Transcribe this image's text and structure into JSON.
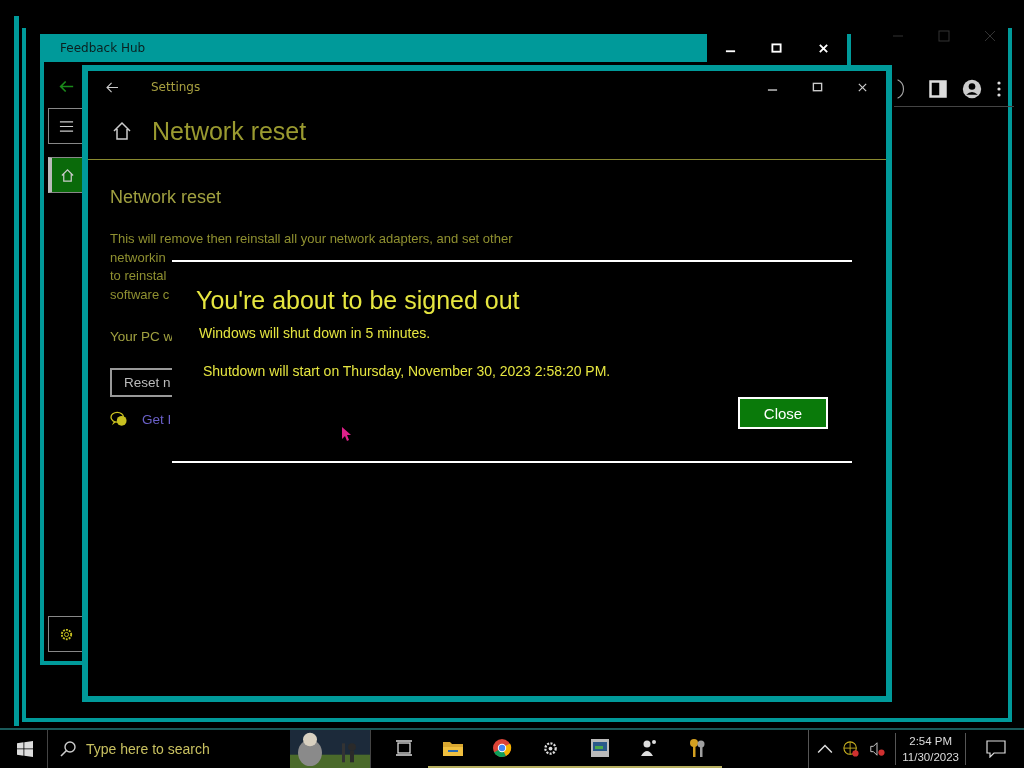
{
  "feedback_hub": {
    "title": "Feedback Hub",
    "nav": [
      {
        "kind": "back",
        "selected": false
      },
      {
        "kind": "menu",
        "selected": false
      },
      {
        "kind": "home",
        "selected": true
      },
      {
        "kind": "settings",
        "selected": false
      }
    ]
  },
  "settings_window": {
    "title": "Settings",
    "page_title": "Network reset",
    "section_title": "Network reset",
    "paragraph_lines": [
      "This will remove then reinstall all your network adapters, and set other",
      "networkin",
      "to reinstal",
      "software c"
    ],
    "note": "Your PC w",
    "reset_button": "Reset n",
    "help_link": "Get I"
  },
  "dialog": {
    "title": "You're about to be signed out",
    "message": "Windows will shut down in 5 minutes.",
    "detail": "Shutdown will start on Thursday, November 30, 2023 2:58:20 PM.",
    "button": "Close"
  },
  "taskbar": {
    "search": {
      "placeholder": "Type here to search"
    },
    "apps": [
      {
        "kind": "taskview",
        "running": false
      },
      {
        "kind": "folder",
        "running": true
      },
      {
        "kind": "chrome",
        "running": true
      },
      {
        "kind": "gear",
        "running": true
      },
      {
        "kind": "monitor",
        "running": true
      },
      {
        "kind": "people",
        "running": true
      },
      {
        "kind": "keys",
        "running": true
      }
    ],
    "time": "2:54 PM",
    "date": "11/30/2023"
  }
}
